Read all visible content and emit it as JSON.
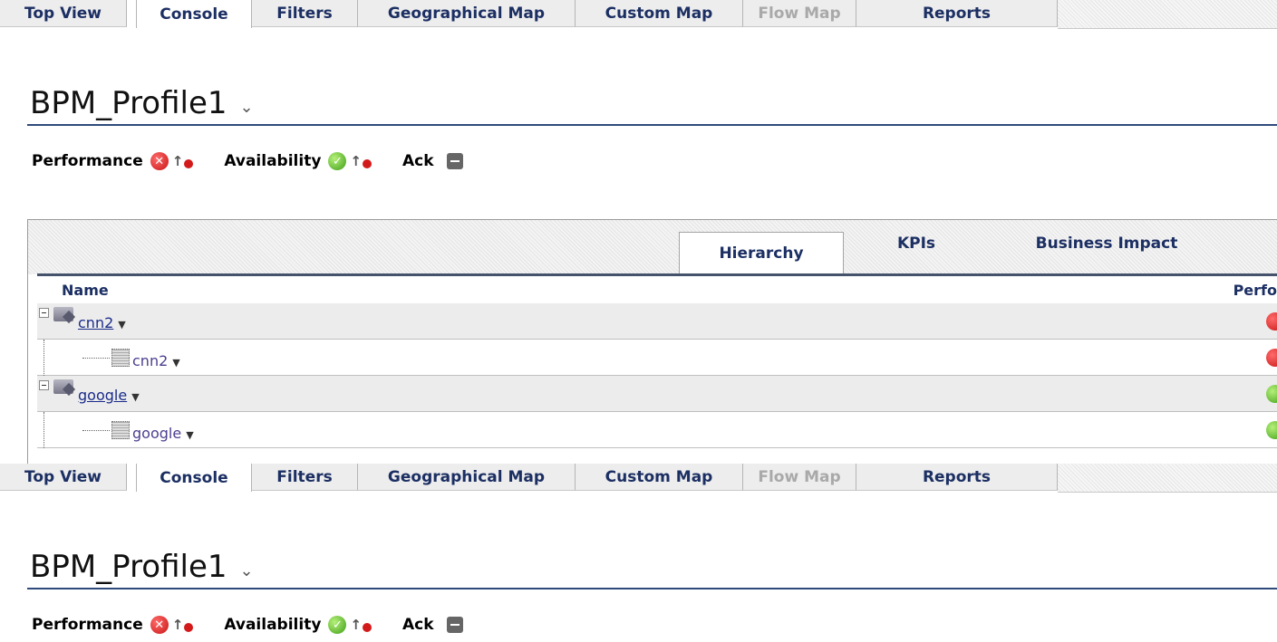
{
  "tabs": [
    {
      "label": "Top View",
      "state": "normal"
    },
    {
      "label": "Console",
      "state": "active"
    },
    {
      "label": "Filters",
      "state": "normal"
    },
    {
      "label": "Geographical Map",
      "state": "normal"
    },
    {
      "label": "Custom Map",
      "state": "normal"
    },
    {
      "label": "Flow Map",
      "state": "disabled"
    },
    {
      "label": "Reports",
      "state": "normal"
    }
  ],
  "page": {
    "title": "BPM_Profile1",
    "title_caret": "⌄"
  },
  "status": {
    "performance_label": "Performance",
    "availability_label": "Availability",
    "ack_label": "Ack"
  },
  "panel": {
    "tabs": [
      {
        "label": "Hierarchy",
        "state": "active"
      },
      {
        "label": "KPIs",
        "state": "normal"
      },
      {
        "label": "Business Impact",
        "state": "normal"
      }
    ],
    "columns": {
      "name": "Name",
      "performance": "Perfo"
    },
    "rows": [
      {
        "kind": "group",
        "label": "cnn2",
        "status": "red"
      },
      {
        "kind": "child",
        "label": "cnn2",
        "status": "red"
      },
      {
        "kind": "group",
        "label": "google",
        "status": "green"
      },
      {
        "kind": "child",
        "label": "google",
        "status": "green"
      }
    ]
  },
  "colors": {
    "tab_text": "#1c2f63",
    "status_red": "#c81414",
    "status_green": "#3f9e17"
  }
}
